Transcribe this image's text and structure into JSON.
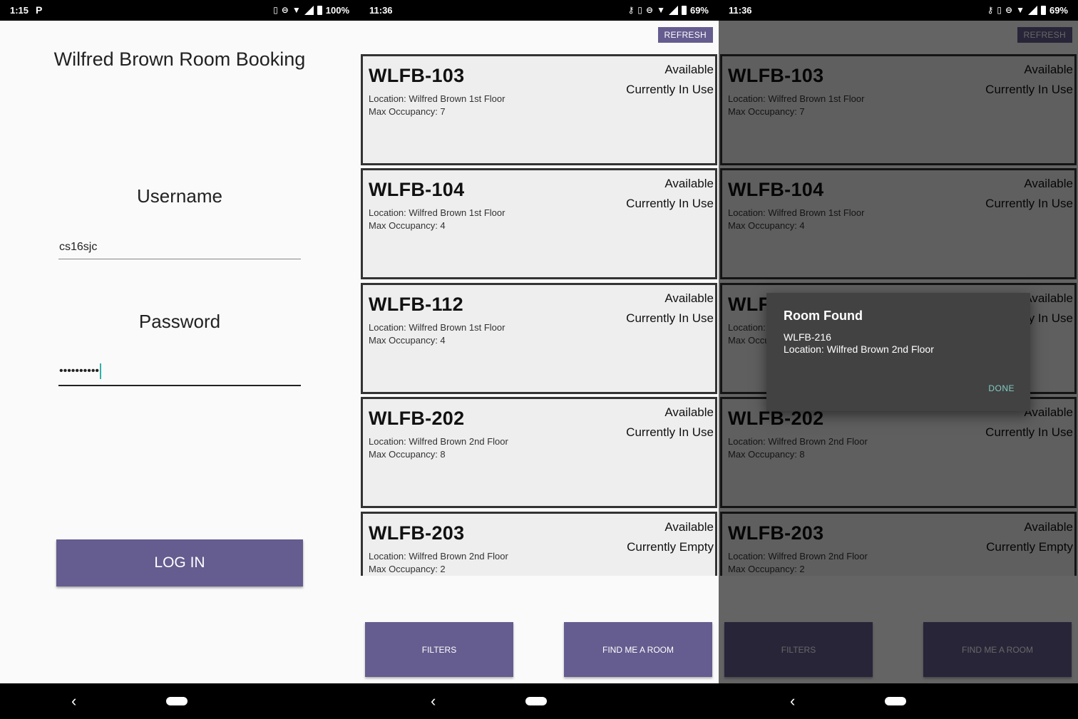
{
  "screens": {
    "login": {
      "status": {
        "time": "1:15",
        "extra": "P",
        "battery": "100%"
      },
      "title": "Wilfred Brown Room Booking",
      "username_label": "Username",
      "username_value": "cs16sjc",
      "password_label": "Password",
      "password_value": "••••••••••",
      "login_button": "LOG IN"
    },
    "list": {
      "status": {
        "time": "11:36",
        "battery": "69%"
      },
      "refresh_button": "REFRESH",
      "filters_button": "FILTERS",
      "find_button": "FIND ME A ROOM"
    },
    "dialog_screen": {
      "status": {
        "time": "11:36",
        "battery": "69%"
      }
    }
  },
  "rooms": [
    {
      "name": "WLFB-103",
      "location": "Location: Wilfred Brown 1st Floor",
      "occupancy": "Max Occupancy: 7",
      "available": "Available",
      "status": "Currently In Use"
    },
    {
      "name": "WLFB-104",
      "location": "Location: Wilfred Brown 1st Floor",
      "occupancy": "Max Occupancy: 4",
      "available": "Available",
      "status": "Currently In Use"
    },
    {
      "name": "WLFB-112",
      "location": "Location: Wilfred Brown 1st Floor",
      "occupancy": "Max Occupancy: 4",
      "available": "Available",
      "status": "Currently In Use"
    },
    {
      "name": "WLFB-202",
      "location": "Location: Wilfred Brown 2nd Floor",
      "occupancy": "Max Occupancy: 8",
      "available": "Available",
      "status": "Currently In Use"
    },
    {
      "name": "WLFB-203",
      "location": "Location: Wilfred Brown 2nd Floor",
      "occupancy": "Max Occupancy: 2",
      "available": "Available",
      "status": "Currently Empty"
    }
  ],
  "dialog": {
    "title": "Room Found",
    "line1": "WLFB-216",
    "line2": "Location: Wilfred Brown 2nd Floor",
    "done_button": "DONE"
  },
  "nav": {
    "back_glyph": "‹"
  },
  "colors": {
    "primary": "#655c8f",
    "card_border": "#333333",
    "dialog_bg": "#424242",
    "accent": "#80cbc4"
  }
}
